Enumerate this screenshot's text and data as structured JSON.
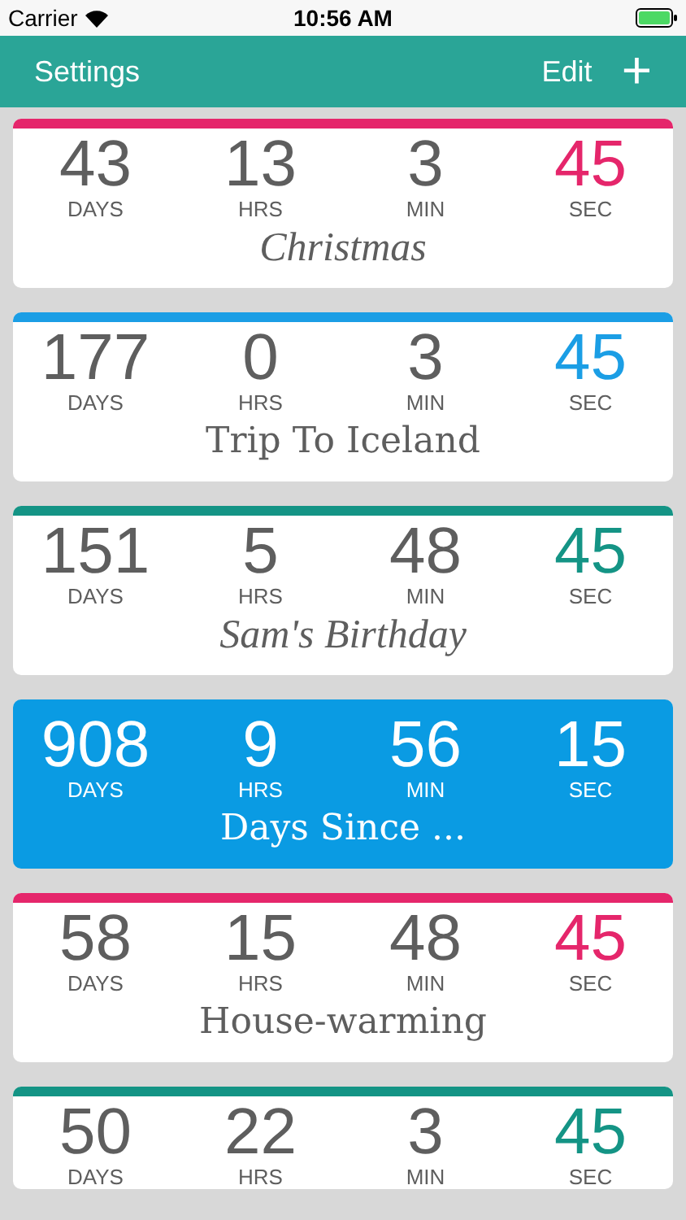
{
  "status_bar": {
    "carrier": "Carrier",
    "time": "10:56 AM"
  },
  "nav_bar": {
    "left": "Settings",
    "edit": "Edit",
    "add": "+"
  },
  "countdowns": [
    {
      "kind": "outline",
      "color": "#e5266b",
      "title": {
        "text": "Christmas",
        "kind": "script"
      },
      "units": [
        {
          "value": "43",
          "label": "DAYS"
        },
        {
          "value": "13",
          "label": "HRS"
        },
        {
          "value": "3",
          "label": "MIN"
        },
        {
          "value": "45",
          "label": "SEC"
        }
      ]
    },
    {
      "kind": "outline",
      "color": "#1b9ee5",
      "title": {
        "text": "Trip To Iceland",
        "kind": "serif"
      },
      "units": [
        {
          "value": "177",
          "label": "DAYS"
        },
        {
          "value": "0",
          "label": "HRS"
        },
        {
          "value": "3",
          "label": "MIN"
        },
        {
          "value": "45",
          "label": "SEC"
        }
      ]
    },
    {
      "kind": "outline",
      "color": "#149485",
      "title": {
        "text": "Sam's Birthday",
        "kind": "script"
      },
      "units": [
        {
          "value": "151",
          "label": "DAYS"
        },
        {
          "value": "5",
          "label": "HRS"
        },
        {
          "value": "48",
          "label": "MIN"
        },
        {
          "value": "45",
          "label": "SEC"
        }
      ]
    },
    {
      "kind": "filled",
      "color": "#0a9be3",
      "title": {
        "text": "Days Since ...",
        "kind": "serif"
      },
      "units": [
        {
          "value": "908",
          "label": "DAYS"
        },
        {
          "value": "9",
          "label": "HRS"
        },
        {
          "value": "56",
          "label": "MIN"
        },
        {
          "value": "15",
          "label": "SEC"
        }
      ]
    },
    {
      "kind": "outline",
      "color": "#e5266b",
      "title": {
        "text": "House-warming",
        "kind": "serif"
      },
      "units": [
        {
          "value": "58",
          "label": "DAYS"
        },
        {
          "value": "15",
          "label": "HRS"
        },
        {
          "value": "48",
          "label": "MIN"
        },
        {
          "value": "45",
          "label": "SEC"
        }
      ]
    },
    {
      "kind": "outline",
      "color": "#149485",
      "units": [
        {
          "value": "50",
          "label": "DAYS"
        },
        {
          "value": "22",
          "label": "HRS"
        },
        {
          "value": "3",
          "label": "MIN"
        },
        {
          "value": "45",
          "label": "SEC"
        }
      ]
    }
  ]
}
